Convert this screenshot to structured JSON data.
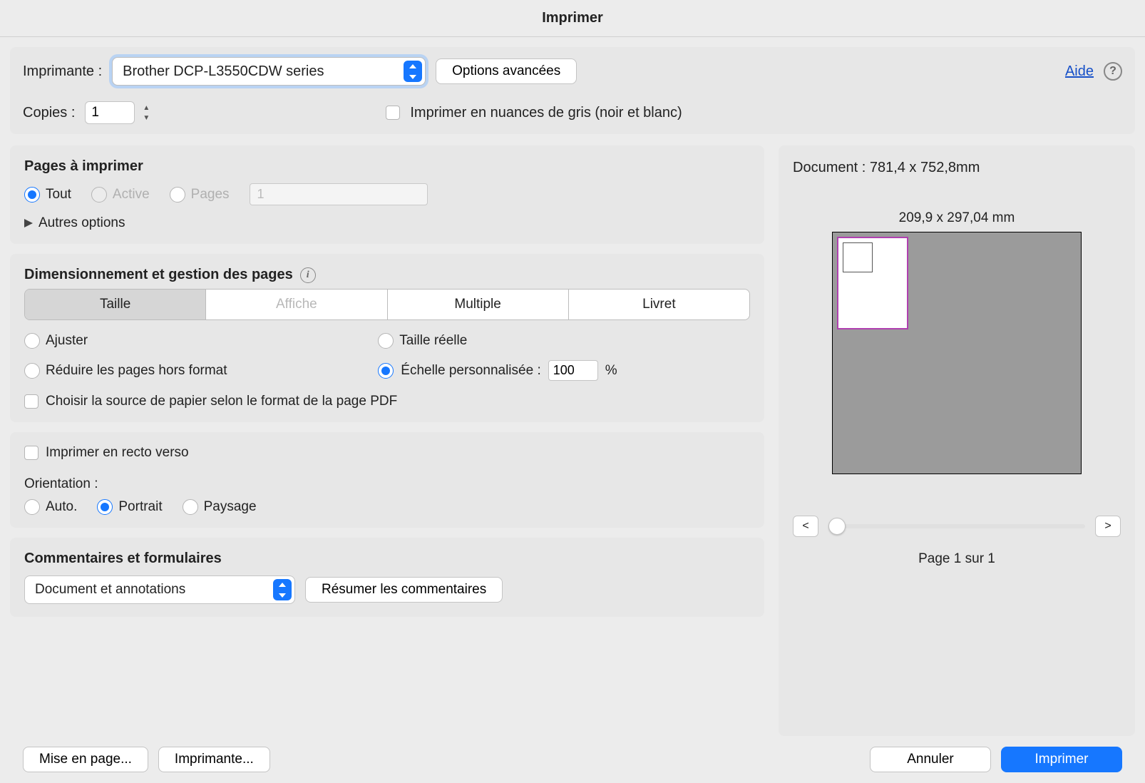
{
  "title": "Imprimer",
  "top": {
    "printer_label": "Imprimante :",
    "printer_value": "Brother DCP-L3550CDW series",
    "advanced_button": "Options avancées",
    "help_link": "Aide",
    "copies_label": "Copies :",
    "copies_value": "1",
    "grayscale_label": "Imprimer en nuances de gris (noir et blanc)"
  },
  "pages": {
    "title": "Pages à imprimer",
    "all": "Tout",
    "active": "Active",
    "range": "Pages",
    "range_value": "1",
    "more": "Autres options"
  },
  "sizing": {
    "title": "Dimensionnement et gestion des pages",
    "tabs": {
      "size": "Taille",
      "poster": "Affiche",
      "multiple": "Multiple",
      "booklet": "Livret"
    },
    "fit": "Ajuster",
    "actual": "Taille réelle",
    "shrink": "Réduire les pages hors format",
    "custom": "Échelle personnalisée :",
    "custom_value": "100",
    "percent": "%",
    "choose_source": "Choisir la source de papier selon le format de la page PDF"
  },
  "duplex": {
    "label": "Imprimer en recto verso",
    "orientation_label": "Orientation :",
    "auto": "Auto.",
    "portrait": "Portrait",
    "landscape": "Paysage"
  },
  "comments": {
    "title": "Commentaires et formulaires",
    "select_value": "Document et annotations",
    "summarize": "Résumer les commentaires"
  },
  "preview": {
    "doc": "Document : 781,4 x 752,8mm",
    "paper": "209,9 x 297,04 mm",
    "prev": "<",
    "next": ">",
    "page_of": "Page 1 sur 1"
  },
  "footer": {
    "page_setup": "Mise en page...",
    "printer": "Imprimante...",
    "cancel": "Annuler",
    "print": "Imprimer"
  }
}
